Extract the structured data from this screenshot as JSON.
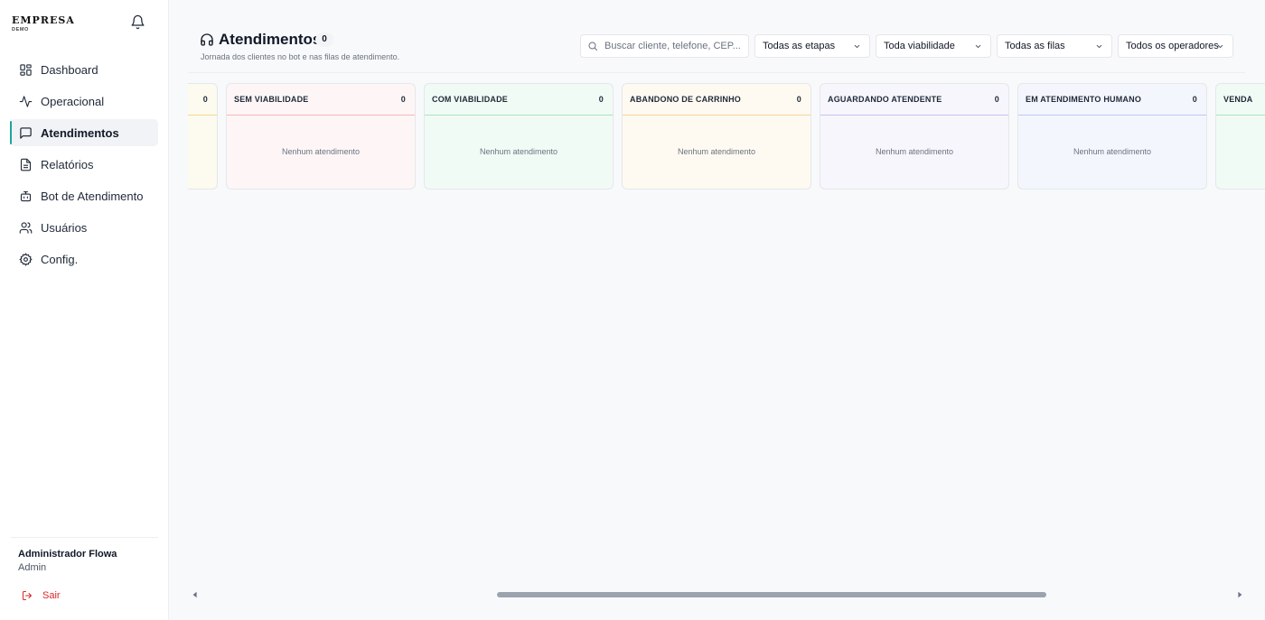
{
  "brand": {
    "name": "EMPRESA",
    "sub": "DEMO"
  },
  "nav": {
    "items": [
      {
        "label": "Dashboard",
        "icon": "dashboard-icon"
      },
      {
        "label": "Operacional",
        "icon": "activity-icon"
      },
      {
        "label": "Atendimentos",
        "icon": "chat-icon",
        "active": true
      },
      {
        "label": "Relatórios",
        "icon": "document-icon"
      },
      {
        "label": "Bot de Atendimento",
        "icon": "bot-icon"
      },
      {
        "label": "Usuários",
        "icon": "users-icon"
      },
      {
        "label": "Config.",
        "icon": "gear-icon"
      }
    ]
  },
  "user": {
    "name": "Administrador Flowa",
    "role": "Admin",
    "logout_label": "Sair"
  },
  "header": {
    "title": "Atendimentos",
    "count": "0",
    "subtitle": "Jornada dos clientes no bot e nas filas de atendimento."
  },
  "filters": {
    "search_placeholder": "Buscar cliente, telefone, CEP...",
    "etapas": "Todas as etapas",
    "viabilidade": "Toda viabilidade",
    "filas": "Todas as filas",
    "operadores": "Todos os operadores"
  },
  "columns": [
    {
      "title": "",
      "count": "0",
      "empty": "",
      "color": "#fdfaf0",
      "accent": "#f4d98a"
    },
    {
      "title": "SEM VIABILIDADE",
      "count": "0",
      "empty": "Nenhum atendimento",
      "color": "#fef6f6",
      "accent": "#f5b7b7"
    },
    {
      "title": "COM VIABILIDADE",
      "count": "0",
      "empty": "Nenhum atendimento",
      "color": "#f1fbf5",
      "accent": "#a7e3c1"
    },
    {
      "title": "ABANDONO DE CARRINHO",
      "count": "0",
      "empty": "Nenhum atendimento",
      "color": "#fffaf1",
      "accent": "#f7d39a"
    },
    {
      "title": "AGUARDANDO ATENDENTE",
      "count": "0",
      "empty": "Nenhum atendimento",
      "color": "#f7f6fd",
      "accent": "#c9c1ee"
    },
    {
      "title": "EM ATENDIMENTO HUMANO",
      "count": "0",
      "empty": "Nenhum atendimento",
      "color": "#f4f6fe",
      "accent": "#bcc8f3"
    },
    {
      "title": "VENDA",
      "count": "",
      "empty": "",
      "color": "#f1fbf5",
      "accent": "#a7e3c1"
    }
  ]
}
